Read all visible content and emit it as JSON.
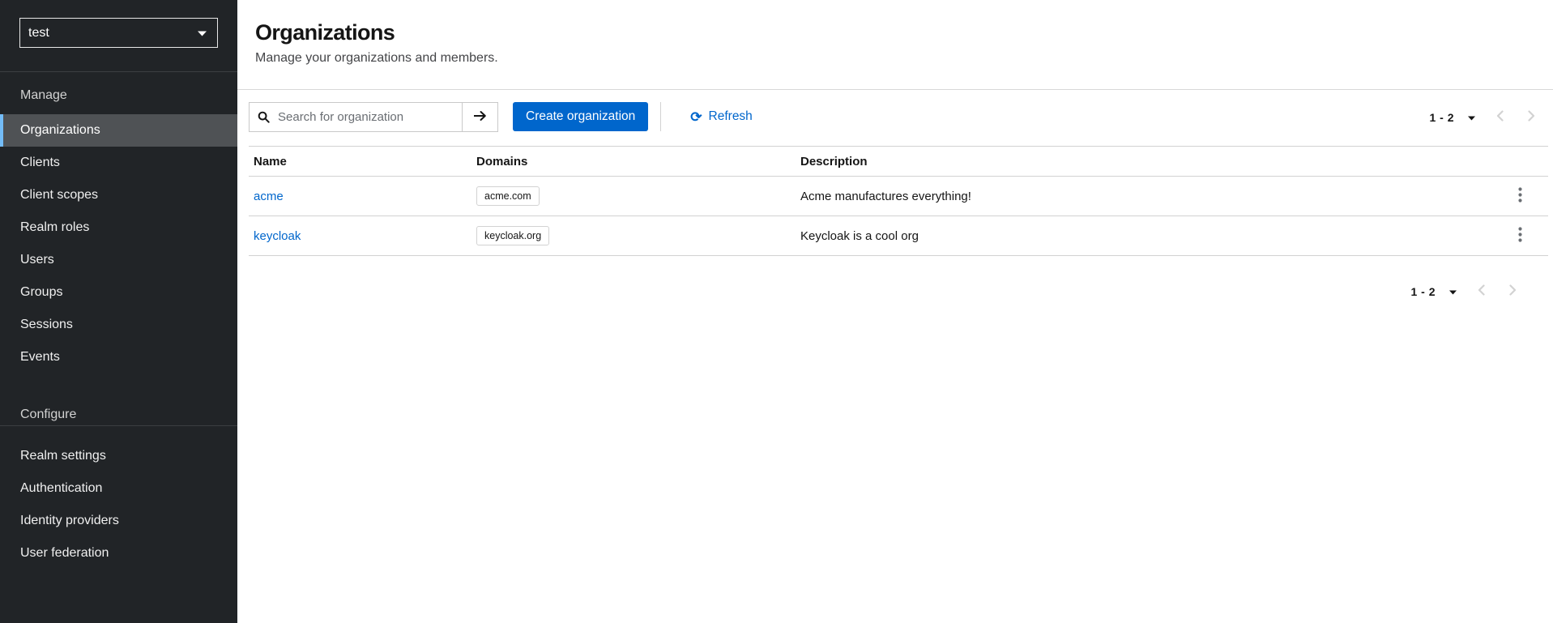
{
  "realm_selector": {
    "current_realm": "test"
  },
  "sidebar": {
    "sections": [
      {
        "label": "Manage",
        "items": [
          {
            "label": "Organizations",
            "selected": true
          },
          {
            "label": "Clients",
            "selected": false
          },
          {
            "label": "Client scopes",
            "selected": false
          },
          {
            "label": "Realm roles",
            "selected": false
          },
          {
            "label": "Users",
            "selected": false
          },
          {
            "label": "Groups",
            "selected": false
          },
          {
            "label": "Sessions",
            "selected": false
          },
          {
            "label": "Events",
            "selected": false
          }
        ]
      },
      {
        "label": "Configure",
        "items": [
          {
            "label": "Realm settings",
            "selected": false
          },
          {
            "label": "Authentication",
            "selected": false
          },
          {
            "label": "Identity providers",
            "selected": false
          },
          {
            "label": "User federation",
            "selected": false
          }
        ]
      }
    ]
  },
  "header": {
    "title": "Organizations",
    "subtitle": "Manage your organizations and members."
  },
  "toolbar": {
    "search": {
      "placeholder": "Search for organization",
      "value": ""
    },
    "create_button": "Create organization",
    "refresh_button": "Refresh",
    "pagination": {
      "range": "1 - 2"
    }
  },
  "table": {
    "columns": {
      "name": "Name",
      "domains": "Domains",
      "description": "Description"
    },
    "rows": [
      {
        "name": "acme",
        "domain": "acme.com",
        "description": "Acme manufactures everything!"
      },
      {
        "name": "keycloak",
        "domain": "keycloak.org",
        "description": "Keycloak is a cool org"
      }
    ]
  },
  "footer_pagination": {
    "range": "1 - 2"
  },
  "icons": {
    "realm_caret": "caret-down-icon",
    "search": "search-icon",
    "search_submit": "arrow-right-icon",
    "refresh": "sync-icon",
    "pagination_caret": "caret-down-icon",
    "prev": "chevron-left-icon",
    "next": "chevron-right-icon",
    "row_actions": "kebab-vertical-icon"
  },
  "colors": {
    "accent_blue": "#0066cc",
    "sidebar_bg": "#212427",
    "sidebar_selected_bg": "#4f5255",
    "sidebar_selected_accent": "#73bcf7",
    "border_gray": "#d2d2d2",
    "disabled_gray": "#d2d2d2",
    "text_dark": "#151515"
  }
}
